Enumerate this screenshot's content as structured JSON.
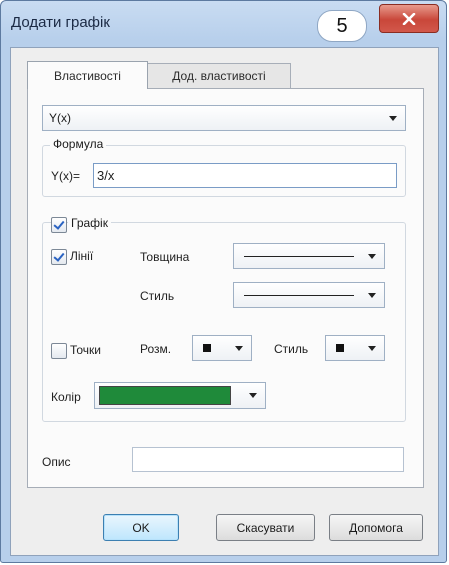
{
  "window": {
    "title": "Додати графік",
    "step_badge": "5",
    "close_symbol": "✕"
  },
  "tabs": [
    {
      "label": "Властивості",
      "active": true
    },
    {
      "label": "Дод. властивості",
      "active": false
    }
  ],
  "function_type": {
    "selected": "Y(x)"
  },
  "formula": {
    "legend": "Формула",
    "prefix": "Y(x)=",
    "value": "3/x"
  },
  "graph": {
    "legend": "Графік",
    "checked": true,
    "lines": {
      "label": "Лінії",
      "checked": true,
      "thickness_label": "Товщина",
      "style_label": "Стиль"
    },
    "points": {
      "label": "Точки",
      "checked": false,
      "size_label": "Розм.",
      "style_label": "Стиль"
    },
    "color": {
      "label": "Колір",
      "value": "#1f8a3a"
    }
  },
  "description": {
    "label": "Опис",
    "value": ""
  },
  "buttons": {
    "ok": "OK",
    "cancel": "Скасувати",
    "help": "Допомога"
  }
}
